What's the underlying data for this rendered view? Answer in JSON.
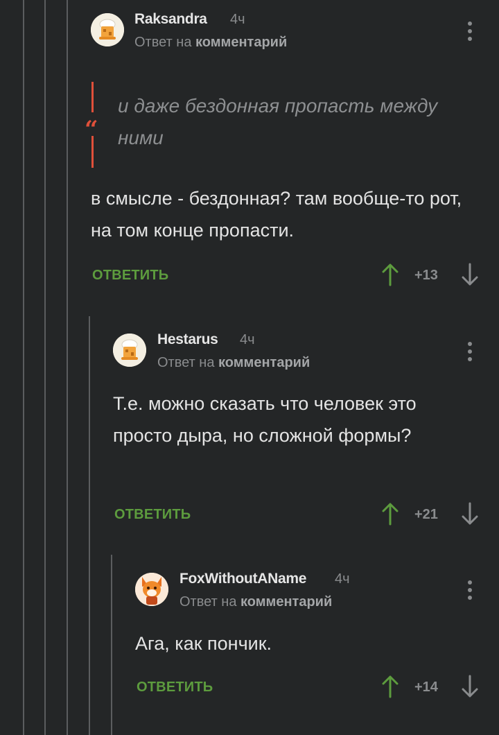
{
  "comments": [
    {
      "author": "Raksandra",
      "time": "4ч",
      "reply_prefix": "Ответ на",
      "reply_target": "комментарий",
      "quote": "и даже бездонная пропасть между ними",
      "quote_icon": "quote-icon",
      "text": "в смысле - бездонная? там вообще-то рот, на том конце пропасти.",
      "reply_label": "ОТВЕТИТЬ",
      "rating": "+13",
      "avatar": "hat-avatar"
    },
    {
      "author": "Hestarus",
      "time": "4ч",
      "reply_prefix": "Ответ на",
      "reply_target": "комментарий",
      "text": "Т.е. можно сказать что человек это просто дыра, но сложной формы?",
      "reply_label": "ОТВЕТИТЬ",
      "rating": "+21",
      "avatar": "hat-avatar"
    },
    {
      "author": "FoxWithoutAName",
      "time": "4ч",
      "reply_prefix": "Ответ на",
      "reply_target": "комментарий",
      "text": "Ага, как пончик.",
      "reply_label": "ОТВЕТИТЬ",
      "rating": "+14",
      "avatar": "fox-avatar"
    }
  ],
  "colors": {
    "background": "#242627",
    "accent_green": "#5d9c3e",
    "quote_red": "#e0503a",
    "muted": "#8a8c8e"
  },
  "icons": [
    "more-vertical-icon",
    "upvote-arrow-icon",
    "downvote-arrow-icon",
    "quote-icon"
  ]
}
